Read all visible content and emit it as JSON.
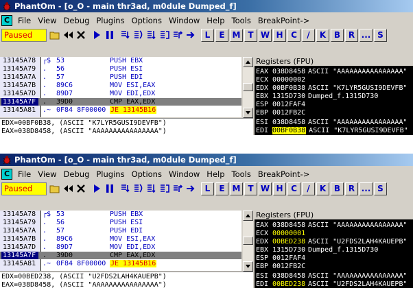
{
  "windows": [
    {
      "title": "PhantOm - [o_O - main thr3ad, m0dule Dumped_f]",
      "menu": [
        "File",
        "View",
        "Debug",
        "Plugins",
        "Options",
        "Window",
        "Help",
        "Tools",
        "BreakPoint->"
      ],
      "status": "Paused",
      "letter_buttons": [
        "L",
        "E",
        "M",
        "T",
        "W",
        "H",
        "C",
        "/",
        "K",
        "B",
        "R",
        "...",
        "S"
      ],
      "cpu_rows": [
        {
          "addr": "13145A78",
          "mark": "┌$",
          "hex": "53",
          "asm": "PUSH EBX"
        },
        {
          "addr": "13145A79",
          "mark": ".",
          "hex": "56",
          "asm": "PUSH ESI"
        },
        {
          "addr": "13145A7A",
          "mark": ".",
          "hex": "57",
          "asm": "PUSH EDI"
        },
        {
          "addr": "13145A7B",
          "mark": ".",
          "hex": "89C6",
          "asm": "MOV ESI,EAX"
        },
        {
          "addr": "13145A7D",
          "mark": ".",
          "hex": "89D7",
          "asm": "MOV EDI,EDX"
        },
        {
          "addr": "13145A7F",
          "mark": ".",
          "hex": "39D0",
          "asm": "CMP EAX,EDX"
        },
        {
          "addr": "13145A81",
          "mark": ".~",
          "hex": "0F84 8F00000",
          "asm": "JE 13145B16"
        }
      ],
      "registers_header": "Registers (FPU)",
      "registers": [
        {
          "name": "EAX",
          "value": "038D8458",
          "comment": "ASCII \"AAAAAAAAAAAAAAAA\"",
          "style": ""
        },
        {
          "name": "ECX",
          "value": "00000002",
          "comment": "",
          "style": ""
        },
        {
          "name": "EDX",
          "value": "00BF0B38",
          "comment": "ASCII \"K7LYR5GUSI9DEVFB\"",
          "style": ""
        },
        {
          "name": "EBX",
          "value": "1315D730",
          "comment": "Dumped_f.1315D730",
          "style": ""
        },
        {
          "name": "ESP",
          "value": "0012FAF4",
          "comment": "",
          "style": ""
        },
        {
          "name": "EBP",
          "value": "0012FB2C",
          "comment": "",
          "style": ""
        },
        {
          "name": "ESI",
          "value": "038D8458",
          "comment": "ASCII \"AAAAAAAAAAAAAAAA\"",
          "style": ""
        },
        {
          "name": "EDI",
          "value": "00BF0B38",
          "comment": "ASCII \"K7LYR5GUSI9DEVFB\"",
          "style": "chgbg"
        }
      ],
      "info_lines": [
        "EDX=00BF0B38, (ASCII \"K7LYR5GUSI9DEVFB\")",
        "EAX=038D8458, (ASCII \"AAAAAAAAAAAAAAAA\")"
      ]
    },
    {
      "title": "PhantOm - [o_O - main thr3ad, m0dule Dumped_f]",
      "menu": [
        "File",
        "View",
        "Debug",
        "Plugins",
        "Options",
        "Window",
        "Help",
        "Tools",
        "BreakPoint->"
      ],
      "status": "Paused",
      "letter_buttons": [
        "L",
        "E",
        "M",
        "T",
        "W",
        "H",
        "C",
        "/",
        "K",
        "B",
        "R",
        "...",
        "S"
      ],
      "cpu_rows": [
        {
          "addr": "13145A78",
          "mark": "┌$",
          "hex": "53",
          "asm": "PUSH EBX"
        },
        {
          "addr": "13145A79",
          "mark": ".",
          "hex": "56",
          "asm": "PUSH ESI"
        },
        {
          "addr": "13145A7A",
          "mark": ".",
          "hex": "57",
          "asm": "PUSH EDI"
        },
        {
          "addr": "13145A7B",
          "mark": ".",
          "hex": "89C6",
          "asm": "MOV ESI,EAX"
        },
        {
          "addr": "13145A7D",
          "mark": ".",
          "hex": "89D7",
          "asm": "MOV EDI,EDX"
        },
        {
          "addr": "13145A7F",
          "mark": ".",
          "hex": "39D0",
          "asm": "CMP EAX,EDX"
        },
        {
          "addr": "13145A81",
          "mark": ".~",
          "hex": "0F84 8F00000",
          "asm": "JE 13145B16"
        }
      ],
      "registers_header": "Registers (FPU)",
      "registers": [
        {
          "name": "EAX",
          "value": "038D8458",
          "comment": "ASCII \"AAAAAAAAAAAAAAAA\"",
          "style": ""
        },
        {
          "name": "ECX",
          "value": "00000001",
          "comment": "",
          "style": "chg"
        },
        {
          "name": "EDX",
          "value": "00BED238",
          "comment": "ASCII \"U2FDS2LAH4KAUEPB\"",
          "style": "chg"
        },
        {
          "name": "EBX",
          "value": "1315D730",
          "comment": "Dumped_f.1315D730",
          "style": ""
        },
        {
          "name": "ESP",
          "value": "0012FAF4",
          "comment": "",
          "style": ""
        },
        {
          "name": "EBP",
          "value": "0012FB2C",
          "comment": "",
          "style": ""
        },
        {
          "name": "ESI",
          "value": "038D8458",
          "comment": "ASCII \"AAAAAAAAAAAAAAAA\"",
          "style": ""
        },
        {
          "name": "EDI",
          "value": "00BED238",
          "comment": "ASCII \"U2FDS2LAH4KAUEPB\"",
          "style": "chg"
        }
      ],
      "info_lines": [
        "EDX=00BED238, (ASCII \"U2FDS2LAH4KAUEPB\")",
        "EAX=038D8458, (ASCII \"AAAAAAAAAAAAAAAA\")"
      ]
    }
  ],
  "colors": {
    "status_bg": "#ffff00",
    "status_text": "#e00000",
    "selected_addr_bg": "#000080",
    "registers_bg": "#000000",
    "changed_value": "#ffff00",
    "jump_highlight_bg": "#ffff00",
    "jump_highlight_text": "#e00000"
  },
  "toolbar_icons": [
    "open-icon",
    "rewind-icon",
    "close-icon",
    "run-icon",
    "pause-icon",
    "step-into-icon",
    "step-over-icon",
    "trace-into-icon",
    "trace-over-icon",
    "execute-till-return-icon",
    "goto-icon"
  ]
}
